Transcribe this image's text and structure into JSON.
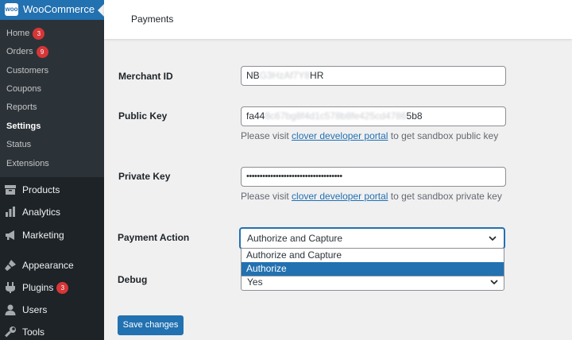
{
  "sidebar": {
    "brand": "WooCommerce",
    "logo_text": "woo",
    "submenu": [
      {
        "label": "Home",
        "badge": "3"
      },
      {
        "label": "Orders",
        "badge": "9"
      },
      {
        "label": "Customers"
      },
      {
        "label": "Coupons"
      },
      {
        "label": "Reports"
      },
      {
        "label": "Settings",
        "active": true
      },
      {
        "label": "Status"
      },
      {
        "label": "Extensions"
      }
    ],
    "menu": [
      {
        "label": "Products",
        "icon": "archive-icon"
      },
      {
        "label": "Analytics",
        "icon": "bar-chart-icon"
      },
      {
        "label": "Marketing",
        "icon": "megaphone-icon"
      },
      {
        "label": "Appearance",
        "icon": "paintbrush-icon"
      },
      {
        "label": "Plugins",
        "icon": "plug-icon",
        "badge": "3"
      },
      {
        "label": "Users",
        "icon": "user-icon"
      },
      {
        "label": "Tools",
        "icon": "wrench-icon"
      }
    ]
  },
  "header": {
    "title": "Payments"
  },
  "form": {
    "merchant_id": {
      "label": "Merchant ID",
      "prefix": "NB",
      "masked": "G3HzAf7Y8",
      "suffix": "HR"
    },
    "public_key": {
      "label": "Public Key",
      "prefix": "fa44",
      "masked": "8c67bg8f4d1c578b8fe425cd4786",
      "suffix": "5b8",
      "desc_prefix": "Please visit ",
      "desc_link": "clover developer portal",
      "desc_suffix": " to get sandbox public key"
    },
    "private_key": {
      "label": "Private Key",
      "value": "••••••••••••••••••••••••••••••••••••",
      "desc_prefix": "Please visit ",
      "desc_link": "clover developer portal",
      "desc_suffix": " to get sandbox private key"
    },
    "payment_action": {
      "label": "Payment Action",
      "value": "Authorize and Capture",
      "options": [
        "Authorize and Capture",
        "Authorize"
      ],
      "highlighted": "Authorize"
    },
    "debug": {
      "label": "Debug",
      "value": "Yes"
    }
  },
  "save_label": "Save changes",
  "colors": {
    "accent": "#2271b1",
    "sidebar_bg": "#1d2327",
    "submenu_bg": "#2c3338",
    "badge": "#d63638"
  }
}
